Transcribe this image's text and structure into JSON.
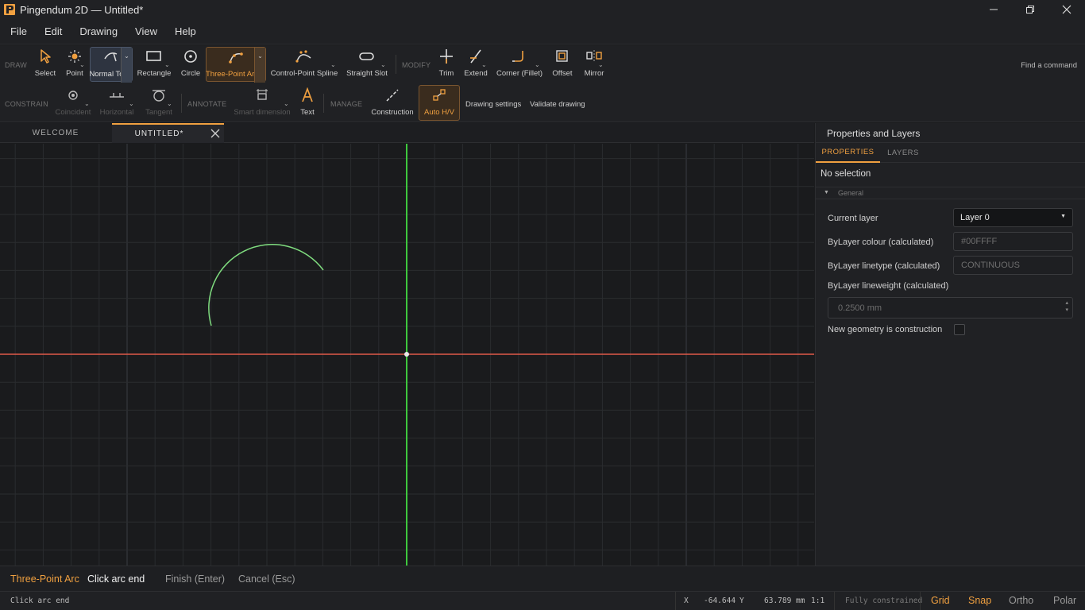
{
  "window": {
    "title": "Pingendum 2D — Untitled*"
  },
  "menu": [
    "File",
    "Edit",
    "Drawing",
    "View",
    "Help"
  ],
  "ribbon": {
    "draw_group": "DRAW",
    "modify_group": "MODIFY",
    "constrain_group": "CONSTRAIN",
    "annotate_group": "ANNOTATE",
    "manage_group": "MANAGE",
    "tools": {
      "select": "Select",
      "point": "Point",
      "normal_to": "Normal To",
      "rectangle": "Rectangle",
      "circle": "Circle",
      "three_point_arc": "Three-Point Arc",
      "control_point_spline": "Control-Point Spline",
      "straight_slot": "Straight Slot",
      "trim": "Trim",
      "extend": "Extend",
      "corner_fillet": "Corner (Fillet)",
      "offset": "Offset",
      "mirror": "Mirror",
      "coincident": "Coincident",
      "horizontal": "Horizontal",
      "tangent": "Tangent",
      "smart_dimension": "Smart dimension",
      "text": "Text",
      "construction": "Construction",
      "auto_hv": "Auto H/V",
      "drawing_settings": "Drawing settings",
      "validate_drawing": "Validate drawing"
    },
    "find_command": "Find a command"
  },
  "tabs": [
    {
      "label": "WELCOME"
    },
    {
      "label": "UNTITLED*"
    }
  ],
  "panel": {
    "title": "Properties and Layers",
    "tabs": [
      "PROPERTIES",
      "LAYERS"
    ],
    "no_selection": "No selection",
    "general": "General",
    "current_layer_label": "Current layer",
    "current_layer_value": "Layer 0",
    "bylayer_colour_label": "ByLayer colour (calculated)",
    "bylayer_colour_value": "#00FFFF",
    "bylayer_linetype_label": "ByLayer linetype (calculated)",
    "bylayer_linetype_value": "CONTINUOUS",
    "bylayer_lineweight_label": "ByLayer lineweight (calculated)",
    "bylayer_lineweight_value": "0.2500 mm",
    "construction_label": "New geometry is construction",
    "construction_checked": false
  },
  "command": {
    "tool": "Three-Point Arc",
    "prompt": "Click arc end",
    "finish": "Finish (Enter)",
    "cancel": "Cancel (Esc)"
  },
  "status": {
    "message": "Click arc end",
    "x_label": "X",
    "x_value": "-64.644",
    "y_label": "Y",
    "y_value": "63.789 mm",
    "scale": "1:1",
    "constraint_state": "Fully constrained",
    "grid": "Grid",
    "snap": "Snap",
    "ortho": "Ortho",
    "polar": "Polar"
  },
  "colors": {
    "accent": "#f0a040",
    "x_axis": "#e05a4a",
    "y_axis": "#3ec93e",
    "arc": "#7fdc7f",
    "grid": "#2a2c2f"
  }
}
